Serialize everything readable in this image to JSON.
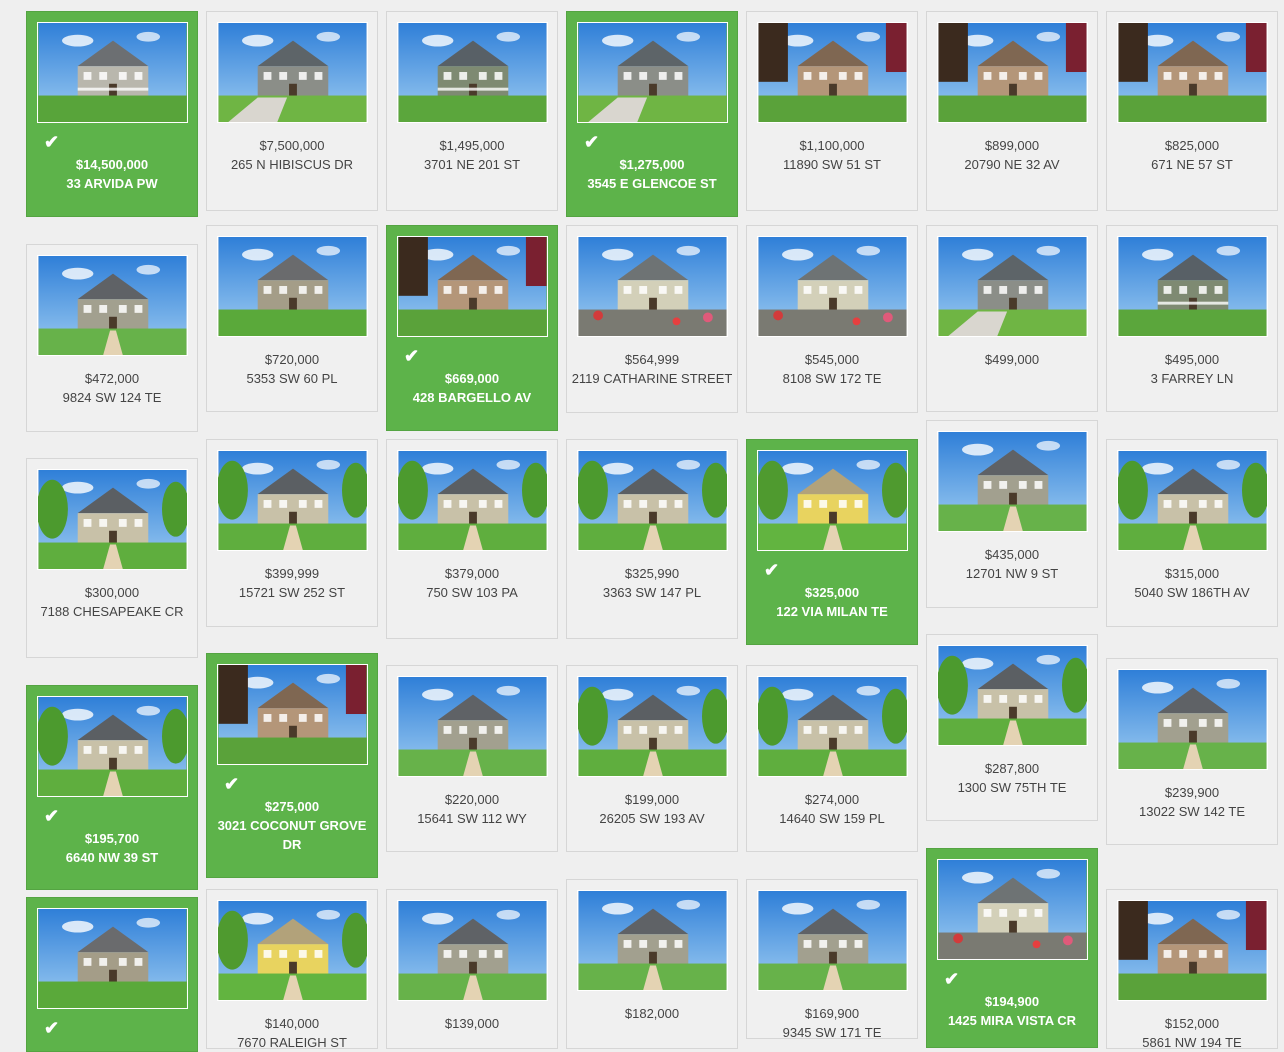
{
  "colors": {
    "selected_bg": "#5db34a",
    "card_bg": "#f0f0f0",
    "text": "#444444"
  },
  "check_icon": "check-icon",
  "columns": [
    [
      {
        "price": "$14,500,000",
        "address": "33 ARVIDA PW",
        "selected": true,
        "photo": "traditional-gray"
      },
      {
        "price": "$472,000",
        "address": "9824 SW 124 TE",
        "selected": false,
        "photo": "craftsman-walkway"
      },
      {
        "price": "$300,000",
        "address": "7188 CHESAPEAKE CR",
        "selected": false,
        "photo": "craftsman-trees"
      },
      {
        "price": "$195,700",
        "address": "6640 NW 39 ST",
        "selected": true,
        "photo": "craftsman-trees"
      },
      {
        "price": "",
        "address": "",
        "selected": true,
        "photo": "craftsman-lawn"
      }
    ],
    [
      {
        "price": "$7,500,000",
        "address": "265 N HIBISCUS DR",
        "selected": false,
        "photo": "gabled-garage"
      },
      {
        "price": "$720,000",
        "address": "5353 SW 60 PL",
        "selected": false,
        "photo": "craftsman-lawn"
      },
      {
        "price": "$399,999",
        "address": "15721 SW 252 ST",
        "selected": false,
        "photo": "craftsman-trees"
      },
      {
        "price": "$275,000",
        "address": "3021 COCONUT GROVE DR",
        "selected": true,
        "photo": "tan-victorian"
      },
      {
        "price": "$140,000",
        "address": "7670 RALEIGH ST",
        "selected": false,
        "photo": "yellow-house"
      }
    ],
    [
      {
        "price": "$1,495,000",
        "address": "3701 NE 201 ST",
        "selected": false,
        "photo": "green-porch"
      },
      {
        "price": "$669,000",
        "address": "428 BARGELLO AV",
        "selected": true,
        "photo": "tan-victorian"
      },
      {
        "price": "$379,000",
        "address": "750 SW 103 PA",
        "selected": false,
        "photo": "craftsman-trees"
      },
      {
        "price": "$220,000",
        "address": "15641 SW 112 WY",
        "selected": false,
        "photo": "craftsman-walkway"
      },
      {
        "price": "$139,000",
        "address": "",
        "selected": false,
        "photo": "craftsman-walkway"
      }
    ],
    [
      {
        "price": "$1,275,000",
        "address": "3545 E GLENCOE ST",
        "selected": true,
        "photo": "gabled-garage"
      },
      {
        "price": "$564,999",
        "address": "2119 CATHARINE STREET",
        "selected": false,
        "photo": "ranch-gravel"
      },
      {
        "price": "$325,990",
        "address": "3363 SW 147 PL",
        "selected": false,
        "photo": "craftsman-trees"
      },
      {
        "price": "$199,000",
        "address": "26205 SW 193 AV",
        "selected": false,
        "photo": "craftsman-trees"
      },
      {
        "price": "$182,000",
        "address": "",
        "selected": false,
        "photo": "craftsman-walkway"
      }
    ],
    [
      {
        "price": "$1,100,000",
        "address": "11890 SW 51 ST",
        "selected": false,
        "photo": "tan-victorian"
      },
      {
        "price": "$545,000",
        "address": "8108 SW 172 TE",
        "selected": false,
        "photo": "ranch-gravel"
      },
      {
        "price": "$325,000",
        "address": "122 VIA MILAN TE",
        "selected": true,
        "photo": "yellow-house"
      },
      {
        "price": "$274,000",
        "address": "14640 SW 159 PL",
        "selected": false,
        "photo": "craftsman-trees"
      },
      {
        "price": "$169,900",
        "address": "9345 SW 171 TE",
        "selected": false,
        "photo": "craftsman-walkway"
      }
    ],
    [
      {
        "price": "$899,000",
        "address": "20790 NE 32 AV",
        "selected": false,
        "photo": "tan-victorian"
      },
      {
        "price": "$499,000",
        "address": "",
        "selected": false,
        "photo": "gabled-garage"
      },
      {
        "price": "$435,000",
        "address": "12701 NW 9 ST",
        "selected": false,
        "photo": "craftsman-walkway"
      },
      {
        "price": "$287,800",
        "address": "1300 SW 75TH TE",
        "selected": false,
        "photo": "craftsman-trees"
      },
      {
        "price": "$194,900",
        "address": "1425 MIRA VISTA CR",
        "selected": true,
        "photo": "ranch-gravel"
      }
    ],
    [
      {
        "price": "$825,000",
        "address": "671 NE 57 ST",
        "selected": false,
        "photo": "tan-victorian"
      },
      {
        "price": "$495,000",
        "address": "3 FARREY LN",
        "selected": false,
        "photo": "green-porch"
      },
      {
        "price": "$315,000",
        "address": "5040 SW 186TH AV",
        "selected": false,
        "photo": "craftsman-trees"
      },
      {
        "price": "$239,900",
        "address": "13022 SW 142 TE",
        "selected": false,
        "photo": "craftsman-walkway"
      },
      {
        "price": "$152,000",
        "address": "5861 NW 194 TE",
        "selected": false,
        "photo": "tan-victorian"
      }
    ]
  ]
}
